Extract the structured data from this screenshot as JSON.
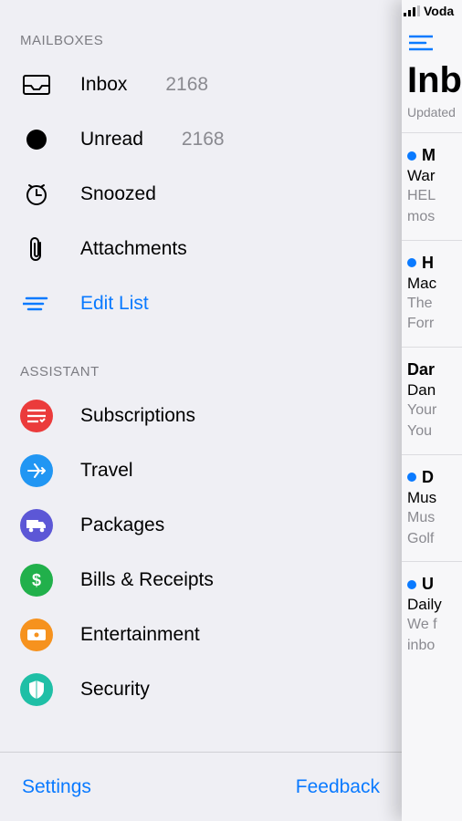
{
  "status": {
    "carrier_partial": "Voda"
  },
  "sidebar": {
    "sections": {
      "mailboxes": {
        "header": "MAILBOXES",
        "items": [
          {
            "icon": "inbox",
            "label": "Inbox",
            "count": "2168"
          },
          {
            "icon": "unread",
            "label": "Unread",
            "count": "2168"
          },
          {
            "icon": "snoozed",
            "label": "Snoozed",
            "count": ""
          },
          {
            "icon": "attachment",
            "label": "Attachments",
            "count": ""
          }
        ],
        "edit": "Edit List"
      },
      "assistant": {
        "header": "ASSISTANT",
        "items": [
          {
            "icon": "subscriptions",
            "label": "Subscriptions"
          },
          {
            "icon": "travel",
            "label": "Travel"
          },
          {
            "icon": "packages",
            "label": "Packages"
          },
          {
            "icon": "bills",
            "label": "Bills & Receipts"
          },
          {
            "icon": "entertainment",
            "label": "Entertainment"
          },
          {
            "icon": "security",
            "label": "Security"
          }
        ]
      }
    },
    "footer": {
      "settings": "Settings",
      "feedback": "Feedback"
    }
  },
  "peek": {
    "menu_icon": "menu",
    "title_partial": "Inb",
    "updated_partial": "Updated",
    "messages": [
      {
        "unread": true,
        "from_partial": "M",
        "subj_partial": "War",
        "prev_partial1": "HEL",
        "prev_partial2": "mos"
      },
      {
        "unread": true,
        "from_partial": "H",
        "subj_partial": "Mac",
        "prev_partial1": "The",
        "prev_partial2": "Forr"
      },
      {
        "unread": false,
        "from_partial": "Dar",
        "subj_partial": "Dan",
        "prev_partial1": "Your",
        "prev_partial2": "You"
      },
      {
        "unread": true,
        "from_partial": "D",
        "subj_partial": "Mus",
        "prev_partial1": "Mus",
        "prev_partial2": "Golf"
      },
      {
        "unread": true,
        "from_partial": "U",
        "subj_partial": "Daily",
        "prev_partial1": "We f",
        "prev_partial2": "inbo"
      }
    ]
  }
}
